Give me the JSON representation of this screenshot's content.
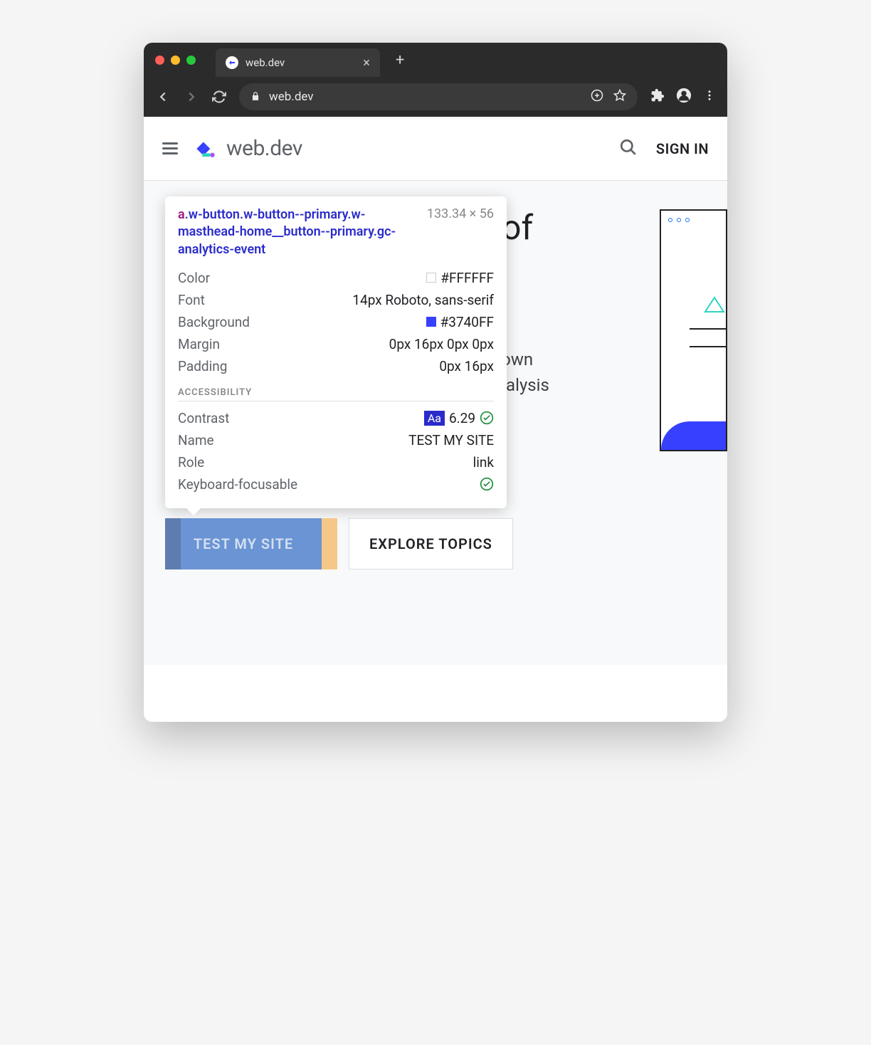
{
  "browser": {
    "tab_title": "web.dev",
    "url": "web.dev"
  },
  "site": {
    "brand": "web.dev",
    "signin": "SIGN IN"
  },
  "hero": {
    "title_fragment": "re of",
    "sub_line1": "your own",
    "sub_line2": "nd analysis"
  },
  "buttons": {
    "primary": "TEST MY SITE",
    "secondary": "EXPLORE TOPICS"
  },
  "tooltip": {
    "tag": "a",
    "selector": ".w-button.w-button--primary.w-masthead-home__button--primary.gc-analytics-event",
    "dimensions": "133.34 × 56",
    "rows": {
      "color_label": "Color",
      "color_value": "#FFFFFF",
      "font_label": "Font",
      "font_value": "14px Roboto, sans-serif",
      "background_label": "Background",
      "background_value": "#3740FF",
      "margin_label": "Margin",
      "margin_value": "0px 16px 0px 0px",
      "padding_label": "Padding",
      "padding_value": "0px 16px"
    },
    "accessibility_label": "ACCESSIBILITY",
    "a11y": {
      "contrast_label": "Contrast",
      "contrast_value": "6.29",
      "aa_badge": "Aa",
      "name_label": "Name",
      "name_value": "TEST MY SITE",
      "role_label": "Role",
      "role_value": "link",
      "keyboard_label": "Keyboard-focusable"
    }
  }
}
